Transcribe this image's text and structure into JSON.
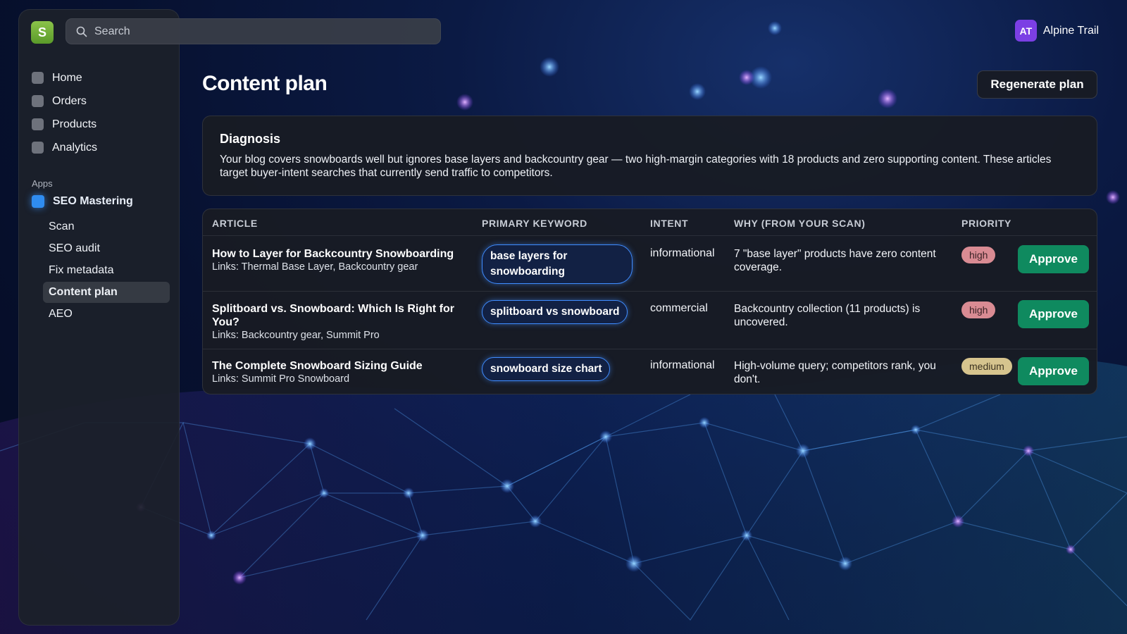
{
  "app": {
    "logo_letter": "S"
  },
  "search": {
    "placeholder": "Search"
  },
  "user": {
    "initials": "AT",
    "name": "Alpine Trail"
  },
  "sidebar": {
    "items": [
      {
        "label": "Home"
      },
      {
        "label": "Orders"
      },
      {
        "label": "Products"
      },
      {
        "label": "Analytics"
      }
    ],
    "apps_label": "Apps",
    "app": {
      "label": "SEO Mastering"
    },
    "subitems": [
      {
        "label": "Scan"
      },
      {
        "label": "SEO audit"
      },
      {
        "label": "Fix metadata"
      },
      {
        "label": "Content plan",
        "active": true
      },
      {
        "label": "AEO"
      }
    ]
  },
  "main": {
    "title": "Content plan",
    "regenerate_label": "Regenerate plan",
    "diagnosis": {
      "title": "Diagnosis",
      "text": "Your blog covers snowboards well but ignores base layers and backcountry gear — two high-margin categories with 18 products and zero supporting content. These articles target buyer-intent searches that currently send traffic to competitors."
    },
    "table": {
      "headers": [
        "ARTICLE",
        "PRIMARY KEYWORD",
        "INTENT",
        "WHY (FROM YOUR SCAN)",
        "PRIORITY"
      ],
      "rows": [
        {
          "title": "How to Layer for Backcountry Snowboarding",
          "links": "Links: Thermal Base Layer, Backcountry gear",
          "keyword": "base layers for snowboarding",
          "intent": "informational",
          "why": "7 \"base layer\" products have zero content coverage.",
          "priority": "high",
          "action": "Approve"
        },
        {
          "title": "Splitboard vs. Snowboard: Which Is Right for You?",
          "links": "Links: Backcountry gear, Summit Pro",
          "keyword": "splitboard vs snowboard",
          "intent": "commercial",
          "why": "Backcountry collection (11 products) is uncovered.",
          "priority": "high",
          "action": "Approve"
        },
        {
          "title": "The Complete Snowboard Sizing Guide",
          "links": "Links: Summit Pro Snowboard",
          "keyword": "snowboard size chart",
          "intent": "informational",
          "why": "High-volume query; competitors rank, you don't.",
          "priority": "medium",
          "action": "Approve"
        }
      ]
    }
  },
  "colors": {
    "accent": "#2f8cf0",
    "approve": "#0f8a5f",
    "priority_high": "#d98b93",
    "priority_medium": "#d6c48e",
    "avatar": "#7b3fe4"
  }
}
